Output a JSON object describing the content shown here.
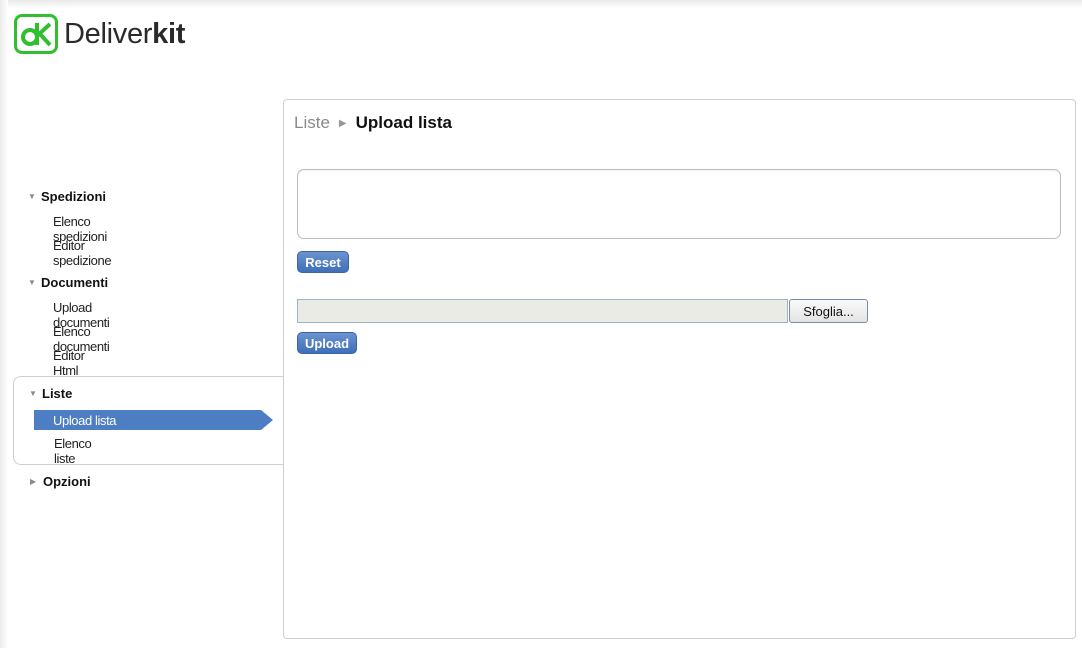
{
  "app": {
    "logo_text_light": "Deliver",
    "logo_text_bold": "kit",
    "brand_color": "#2fbf2f",
    "accent_color": "#4d7dc3"
  },
  "sidebar": {
    "sections": [
      {
        "label": "Spedizioni",
        "expanded": true,
        "items": [
          "Elenco spedizioni",
          "Editor spedizione"
        ]
      },
      {
        "label": "Documenti",
        "expanded": true,
        "items": [
          "Upload documenti",
          "Elenco documenti",
          "Editor Html"
        ]
      },
      {
        "label": "Liste",
        "expanded": true,
        "active_item": "Upload lista",
        "items": [
          "Upload lista",
          "Elenco liste"
        ]
      },
      {
        "label": "Opzioni",
        "expanded": false,
        "items": []
      }
    ],
    "arrow_expanded": "▼",
    "arrow_collapsed": "▶"
  },
  "main": {
    "breadcrumb": {
      "parent": "Liste",
      "separator": "▶",
      "current": "Upload lista"
    },
    "reset_label": "Reset",
    "browse_label": "Sfoglia...",
    "upload_label": "Upload",
    "file_value": ""
  }
}
